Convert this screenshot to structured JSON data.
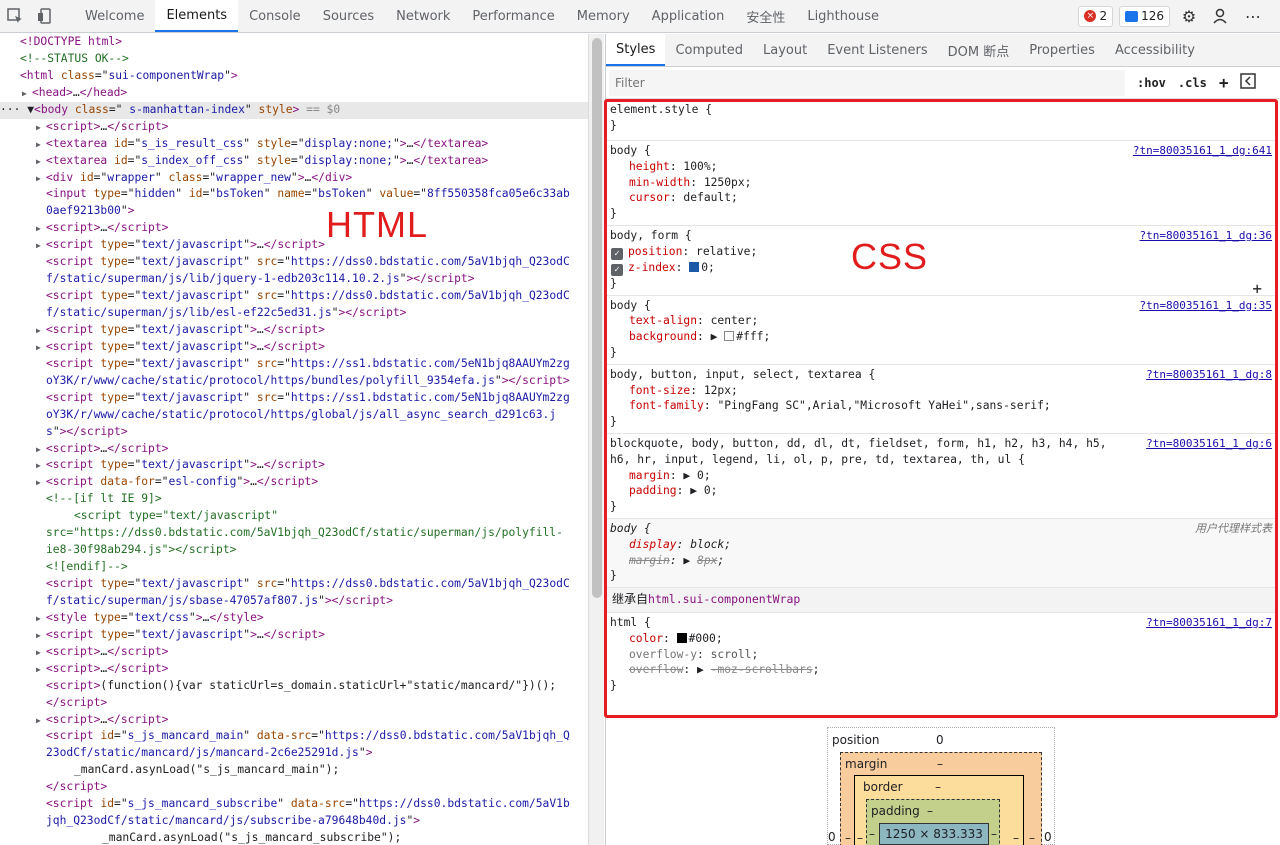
{
  "toolbar": {
    "tabs": [
      "Welcome",
      "Elements",
      "Console",
      "Sources",
      "Network",
      "Performance",
      "Memory",
      "Application",
      "安全性",
      "Lighthouse"
    ],
    "error_count": "2",
    "message_count": "126"
  },
  "elements": {
    "lines": [
      {
        "indent": 20,
        "tri": "",
        "html": "<span class='tag'>&lt;!DOCTYPE html&gt;</span>"
      },
      {
        "indent": 20,
        "tri": "",
        "html": "<span class='cmt'>&lt;!--STATUS OK--&gt;</span>"
      },
      {
        "indent": 20,
        "tri": "",
        "html": "<span class='tag'>&lt;html</span> <span class='attr'>class</span>=\"<span class='val'>sui-componentWrap</span>\"<span class='tag'>&gt;</span>"
      },
      {
        "indent": 22,
        "tri": "▶",
        "html": "<span class='tag'>&lt;head&gt;</span>…<span class='tag'>&lt;/head&gt;</span>"
      },
      {
        "indent": 0,
        "tri": "",
        "sel": true,
        "html": "··· ▼<span class='tag'>&lt;body</span> <span class='attr'>class</span>=\"<span class='val'> s-manhattan-index</span>\" <span class='attr'>style</span><span class='tag'>&gt;</span> <span style='color:#888'>== $0</span>"
      },
      {
        "indent": 36,
        "tri": "▶",
        "html": "<span class='tag'>&lt;script&gt;</span>…<span class='tag'>&lt;/script&gt;</span>"
      },
      {
        "indent": 36,
        "tri": "▶",
        "html": "<span class='tag'>&lt;textarea</span> <span class='attr'>id</span>=\"<span class='val'>s_is_result_css</span>\" <span class='attr'>style</span>=\"<span class='val'>display:none;</span>\"<span class='tag'>&gt;</span>…<span class='tag'>&lt;/textarea&gt;</span>"
      },
      {
        "indent": 36,
        "tri": "▶",
        "html": "<span class='tag'>&lt;textarea</span> <span class='attr'>id</span>=\"<span class='val'>s_index_off_css</span>\" <span class='attr'>style</span>=\"<span class='val'>display:none;</span>\"<span class='tag'>&gt;</span>…<span class='tag'>&lt;/textarea&gt;</span>"
      },
      {
        "indent": 36,
        "tri": "▶",
        "html": "<span class='tag'>&lt;div</span> <span class='attr'>id</span>=\"<span class='val'>wrapper</span>\" <span class='attr'>class</span>=\"<span class='val'>wrapper_new</span>\"<span class='tag'>&gt;</span>…<span class='tag'>&lt;/div&gt;</span>"
      },
      {
        "indent": 46,
        "tri": "",
        "html": "<span class='tag'>&lt;input</span> <span class='attr'>type</span>=\"<span class='val'>hidden</span>\" <span class='attr'>id</span>=\"<span class='val'>bsToken</span>\" <span class='attr'>name</span>=\"<span class='val'>bsToken</span>\" <span class='attr'>value</span>=\"<span class='val'>8ff550358fca05e6c33ab</span>"
      },
      {
        "indent": 46,
        "tri": "",
        "html": "<span class='val'>0aef9213b00</span>\"<span class='tag'>&gt;</span>"
      },
      {
        "indent": 36,
        "tri": "▶",
        "html": "<span class='tag'>&lt;script&gt;</span>…<span class='tag'>&lt;/script&gt;</span>"
      },
      {
        "indent": 36,
        "tri": "▶",
        "html": "<span class='tag'>&lt;script</span> <span class='attr'>type</span>=\"<span class='val'>text/javascript</span>\"<span class='tag'>&gt;</span>…<span class='tag'>&lt;/script&gt;</span>"
      },
      {
        "indent": 46,
        "tri": "",
        "html": "<span class='tag'>&lt;script</span> <span class='attr'>type</span>=\"<span class='val'>text/javascript</span>\" <span class='attr'>src</span>=\"<span class='val'>https://dss0.bdstatic.com/5aV1bjqh_Q23odC</span>"
      },
      {
        "indent": 46,
        "tri": "",
        "html": "<span class='val'>f/static/superman/js/lib/jquery-1-edb203c114.10.2.js</span>\"<span class='tag'>&gt;&lt;/script&gt;</span>"
      },
      {
        "indent": 46,
        "tri": "",
        "html": "<span class='tag'>&lt;script</span> <span class='attr'>type</span>=\"<span class='val'>text/javascript</span>\" <span class='attr'>src</span>=\"<span class='val'>https://dss0.bdstatic.com/5aV1bjqh_Q23odC</span>"
      },
      {
        "indent": 46,
        "tri": "",
        "html": "<span class='val'>f/static/superman/js/lib/esl-ef22c5ed31.js</span>\"<span class='tag'>&gt;&lt;/script&gt;</span>"
      },
      {
        "indent": 36,
        "tri": "▶",
        "html": "<span class='tag'>&lt;script</span> <span class='attr'>type</span>=\"<span class='val'>text/javascript</span>\"<span class='tag'>&gt;</span>…<span class='tag'>&lt;/script&gt;</span>"
      },
      {
        "indent": 36,
        "tri": "▶",
        "html": "<span class='tag'>&lt;script</span> <span class='attr'>type</span>=\"<span class='val'>text/javascript</span>\"<span class='tag'>&gt;</span>…<span class='tag'>&lt;/script&gt;</span>"
      },
      {
        "indent": 46,
        "tri": "",
        "html": "<span class='tag'>&lt;script</span> <span class='attr'>type</span>=\"<span class='val'>text/javascript</span>\" <span class='attr'>src</span>=\"<span class='val'>https://ss1.bdstatic.com/5eN1bjq8AAUYm2zg</span>"
      },
      {
        "indent": 46,
        "tri": "",
        "html": "<span class='val'>oY3K/r/www/cache/static/protocol/https/bundles/polyfill_9354efa.js</span>\"<span class='tag'>&gt;&lt;/script&gt;</span>"
      },
      {
        "indent": 46,
        "tri": "",
        "html": "<span class='tag'>&lt;script</span> <span class='attr'>type</span>=\"<span class='val'>text/javascript</span>\" <span class='attr'>src</span>=\"<span class='val'>https://ss1.bdstatic.com/5eN1bjq8AAUYm2zg</span>"
      },
      {
        "indent": 46,
        "tri": "",
        "html": "<span class='val'>oY3K/r/www/cache/static/protocol/https/global/js/all_async_search_d291c63.j</span>"
      },
      {
        "indent": 46,
        "tri": "",
        "html": "<span class='val'>s</span>\"<span class='tag'>&gt;&lt;/script&gt;</span>"
      },
      {
        "indent": 36,
        "tri": "▶",
        "html": "<span class='tag'>&lt;script&gt;</span>…<span class='tag'>&lt;/script&gt;</span>"
      },
      {
        "indent": 36,
        "tri": "▶",
        "html": "<span class='tag'>&lt;script</span> <span class='attr'>type</span>=\"<span class='val'>text/javascript</span>\"<span class='tag'>&gt;</span>…<span class='tag'>&lt;/script&gt;</span>"
      },
      {
        "indent": 36,
        "tri": "▶",
        "html": "<span class='tag'>&lt;script</span> <span class='attr'>data-for</span>=\"<span class='val'>esl-config</span>\"<span class='tag'>&gt;</span>…<span class='tag'>&lt;/script&gt;</span>"
      },
      {
        "indent": 46,
        "tri": "",
        "html": "<span class='cmt'>&lt;!--[if lt IE 9]&gt;</span>"
      },
      {
        "indent": 74,
        "tri": "",
        "html": "<span class='cmt'>&lt;script type=\"text/javascript\"</span>"
      },
      {
        "indent": 46,
        "tri": "",
        "html": "<span class='cmt'>src=\"https://dss0.bdstatic.com/5aV1bjqh_Q23odCf/static/superman/js/polyfill-</span>"
      },
      {
        "indent": 46,
        "tri": "",
        "html": "<span class='cmt'>ie8-30f98ab294.js\"&gt;&lt;/script&gt;</span>"
      },
      {
        "indent": 46,
        "tri": "",
        "html": "<span class='cmt'>&lt;![endif]--&gt;</span>"
      },
      {
        "indent": 46,
        "tri": "",
        "html": "<span class='tag'>&lt;script</span> <span class='attr'>type</span>=\"<span class='val'>text/javascript</span>\" <span class='attr'>src</span>=\"<span class='val'>https://dss0.bdstatic.com/5aV1bjqh_Q23odC</span>"
      },
      {
        "indent": 46,
        "tri": "",
        "html": "<span class='val'>f/static/superman/js/sbase-47057af807.js</span>\"<span class='tag'>&gt;&lt;/script&gt;</span>"
      },
      {
        "indent": 36,
        "tri": "▶",
        "html": "<span class='tag'>&lt;style</span> <span class='attr'>type</span>=\"<span class='val'>text/css</span>\"<span class='tag'>&gt;</span>…<span class='tag'>&lt;/style&gt;</span>"
      },
      {
        "indent": 36,
        "tri": "▶",
        "html": "<span class='tag'>&lt;script</span> <span class='attr'>type</span>=\"<span class='val'>text/javascript</span>\"<span class='tag'>&gt;</span>…<span class='tag'>&lt;/script&gt;</span>"
      },
      {
        "indent": 36,
        "tri": "▶",
        "html": "<span class='tag'>&lt;script&gt;</span>…<span class='tag'>&lt;/script&gt;</span>"
      },
      {
        "indent": 36,
        "tri": "▶",
        "html": "<span class='tag'>&lt;script&gt;</span>…<span class='tag'>&lt;/script&gt;</span>"
      },
      {
        "indent": 46,
        "tri": "",
        "html": "<span class='tag'>&lt;script&gt;</span>(function(){var staticUrl=s_domain.staticUrl+\"static/mancard/\"})();"
      },
      {
        "indent": 46,
        "tri": "",
        "html": "<span class='tag'>&lt;/script&gt;</span>"
      },
      {
        "indent": 36,
        "tri": "▶",
        "html": "<span class='tag'>&lt;script&gt;</span>…<span class='tag'>&lt;/script&gt;</span>"
      },
      {
        "indent": 46,
        "tri": "",
        "html": "<span class='tag'>&lt;script</span> <span class='attr'>id</span>=\"<span class='val'>s_js_mancard_main</span>\" <span class='attr'>data-src</span>=\"<span class='val'>https://dss0.bdstatic.com/5aV1bjqh_Q</span>"
      },
      {
        "indent": 46,
        "tri": "",
        "html": "<span class='val'>23odCf/static/mancard/js/mancard-2c6e25291d.js</span>\"<span class='tag'>&gt;</span>"
      },
      {
        "indent": 74,
        "tri": "",
        "html": "_manCard.asynLoad(\"s_js_mancard_main\");"
      },
      {
        "indent": 46,
        "tri": "",
        "html": "<span class='tag'>&lt;/script&gt;</span>"
      },
      {
        "indent": 46,
        "tri": "",
        "html": "<span class='tag'>&lt;script</span> <span class='attr'>id</span>=\"<span class='val'>s_js_mancard_subscribe</span>\" <span class='attr'>data-src</span>=\"<span class='val'>https://dss0.bdstatic.com/5aV1b</span>"
      },
      {
        "indent": 46,
        "tri": "",
        "html": "<span class='val'>jqh_Q23odCf/static/mancard/js/subscribe-a79648b40d.js</span>\"<span class='tag'>&gt;</span>"
      },
      {
        "indent": 102,
        "tri": "",
        "html": "_manCard.asynLoad(\"s_js_mancard_subscribe\");"
      }
    ]
  },
  "annotations": {
    "html_label": "HTML",
    "css_label": "CSS"
  },
  "styles": {
    "subtabs": [
      "Styles",
      "Computed",
      "Layout",
      "Event Listeners",
      "DOM 断点",
      "Properties",
      "Accessibility"
    ],
    "filter_placeholder": "Filter",
    "hov": ":hov",
    "cls": ".cls",
    "inherited_prefix": "继承自",
    "inherited_element": "html.sui-componentWrap",
    "ua_label": "用户代理样式表"
  },
  "boxmodel": {
    "position_label": "position",
    "position_value": "0",
    "margin_label": "margin",
    "margin_value": "–",
    "border_label": "border",
    "border_value": "–",
    "padding_label": "padding",
    "padding_value": "–",
    "content": "1250 × 833.333",
    "left_outer": "0",
    "right_outer": "0",
    "dash": "–"
  }
}
